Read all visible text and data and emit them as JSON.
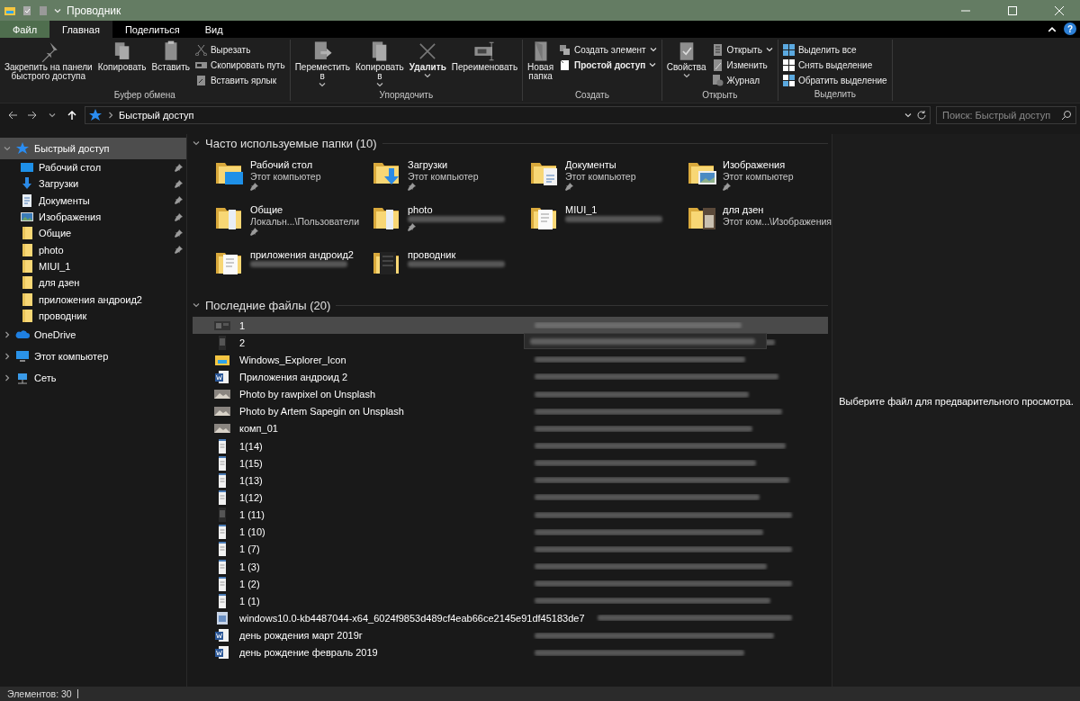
{
  "window": {
    "title": "Проводник"
  },
  "ribbon_tabs": [
    {
      "label": "Файл",
      "kind": "file",
      "selected": false
    },
    {
      "label": "Главная",
      "kind": "tab",
      "selected": true
    },
    {
      "label": "Поделиться",
      "kind": "tab",
      "selected": false
    },
    {
      "label": "Вид",
      "kind": "tab",
      "selected": false
    }
  ],
  "help_button": "?",
  "ribbon_groups": [
    {
      "label": "Буфер обмена",
      "items": [
        {
          "kind": "large",
          "lines": [
            "Закрепить на панели",
            "быстрого доступа"
          ],
          "dropdown": false,
          "bold": false
        },
        {
          "kind": "large",
          "lines": [
            "Копировать"
          ],
          "dropdown": false,
          "bold": false
        },
        {
          "kind": "large",
          "lines": [
            "Вставить"
          ],
          "dropdown": false,
          "bold": false
        },
        {
          "kind": "small",
          "lines": [
            "Вырезать"
          ],
          "dropdown": false,
          "bold": false
        },
        {
          "kind": "small",
          "lines": [
            "Скопировать путь"
          ],
          "dropdown": false,
          "bold": false
        },
        {
          "kind": "small",
          "lines": [
            "Вставить ярлык"
          ],
          "dropdown": false,
          "bold": false
        }
      ]
    },
    {
      "label": "Упорядочить",
      "items": [
        {
          "kind": "large",
          "lines": [
            "Переместить",
            "в"
          ],
          "dropdown": true,
          "bold": false
        },
        {
          "kind": "large",
          "lines": [
            "Копировать",
            "в"
          ],
          "dropdown": true,
          "bold": false
        },
        {
          "kind": "large",
          "lines": [
            "Удалить"
          ],
          "dropdown": true,
          "bold": true
        },
        {
          "kind": "large",
          "lines": [
            "Переименовать"
          ],
          "dropdown": false,
          "bold": false
        }
      ]
    },
    {
      "label": "Создать",
      "items": [
        {
          "kind": "large",
          "lines": [
            "Новая",
            "папка"
          ],
          "dropdown": false,
          "bold": false
        },
        {
          "kind": "small",
          "lines": [
            "Создать элемент"
          ],
          "dropdown": true,
          "bold": false
        },
        {
          "kind": "small",
          "lines": [
            "Простой доступ"
          ],
          "dropdown": true,
          "bold": true
        }
      ]
    },
    {
      "label": "Открыть",
      "items": [
        {
          "kind": "large",
          "lines": [
            "Свойства"
          ],
          "dropdown": true,
          "bold": false
        },
        {
          "kind": "small",
          "lines": [
            "Открыть"
          ],
          "dropdown": true,
          "bold": false
        },
        {
          "kind": "small",
          "lines": [
            "Изменить"
          ],
          "dropdown": false,
          "bold": false
        },
        {
          "kind": "small",
          "lines": [
            "Журнал"
          ],
          "dropdown": false,
          "bold": false
        }
      ]
    },
    {
      "label": "Выделить",
      "items": [
        {
          "kind": "small",
          "lines": [
            "Выделить все"
          ],
          "dropdown": false,
          "bold": false
        },
        {
          "kind": "small",
          "lines": [
            "Снять выделение"
          ],
          "dropdown": false,
          "bold": false
        },
        {
          "kind": "small",
          "lines": [
            "Обратить выделение"
          ],
          "dropdown": false,
          "bold": false
        }
      ]
    }
  ],
  "address": {
    "path": "Быстрый доступ",
    "search_placeholder": "Поиск: Быстрый доступ"
  },
  "sidebar": {
    "items": [
      {
        "label": "Быстрый доступ",
        "kind": "quick-access",
        "selected": true,
        "expanded": true,
        "children": [
          {
            "label": "Рабочий стол",
            "kind": "desktop",
            "pinned": true
          },
          {
            "label": "Загрузки",
            "kind": "downloads",
            "pinned": true
          },
          {
            "label": "Документы",
            "kind": "documents",
            "pinned": true
          },
          {
            "label": "Изображения",
            "kind": "pictures",
            "pinned": true
          },
          {
            "label": "Общие",
            "kind": "folder",
            "pinned": true
          },
          {
            "label": "photo",
            "kind": "folder",
            "pinned": true
          },
          {
            "label": "MIUI_1",
            "kind": "folder",
            "pinned": false
          },
          {
            "label": "для дзен",
            "kind": "folder",
            "pinned": false
          },
          {
            "label": "приложения андроид2",
            "kind": "folder",
            "pinned": false
          },
          {
            "label": "проводник",
            "kind": "folder",
            "pinned": false
          }
        ]
      },
      {
        "label": "OneDrive",
        "kind": "onedrive",
        "selected": false,
        "expanded": false
      },
      {
        "label": "Этот компьютер",
        "kind": "computer",
        "selected": false,
        "expanded": false
      },
      {
        "label": "Сеть",
        "kind": "network",
        "selected": false,
        "expanded": false
      }
    ]
  },
  "frequent_folders": {
    "title": "Часто используемые папки (10)",
    "expanded": true,
    "items": [
      {
        "name": "Рабочий стол",
        "location": "Этот компьютер",
        "kind": "desktop",
        "pinned": true
      },
      {
        "name": "Загрузки",
        "location": "Этот компьютер",
        "kind": "downloads",
        "pinned": true
      },
      {
        "name": "Документы",
        "location": "Этот компьютер",
        "kind": "documents",
        "pinned": true
      },
      {
        "name": "Изображения",
        "location": "Этот компьютер",
        "kind": "pictures",
        "pinned": true
      },
      {
        "name": "Общие",
        "location": "Локальн...\\Пользователи",
        "kind": "folder",
        "pinned": true
      },
      {
        "name": "photo",
        "kind": "folder",
        "pinned": true
      },
      {
        "name": "MIUI_1",
        "kind": "pages",
        "pinned": false
      },
      {
        "name": "для дзен",
        "location": "Этот ком...\\Изображения",
        "kind": "photos",
        "pinned": false
      },
      {
        "name": "приложения андроид2",
        "kind": "pages",
        "pinned": false
      },
      {
        "name": "проводник",
        "kind": "dark",
        "pinned": false
      }
    ]
  },
  "recent_files": {
    "title": "Последние файлы (20)",
    "expanded": true,
    "items": [
      {
        "name": "1",
        "kind": "screenshot",
        "selected": true,
        "tooltip": false
      },
      {
        "name": "2",
        "kind": "phone-dark",
        "selected": false,
        "tooltip": true
      },
      {
        "name": "Windows_Explorer_Icon",
        "kind": "explorer",
        "selected": false,
        "tooltip": false
      },
      {
        "name": "Приложения андроид 2",
        "kind": "word",
        "selected": false,
        "tooltip": false
      },
      {
        "name": "Photo by rawpixel on Unsplash",
        "kind": "photo",
        "selected": false,
        "tooltip": false
      },
      {
        "name": "Photo by Artem Sapegin on Unsplash",
        "kind": "photo",
        "selected": false,
        "tooltip": false
      },
      {
        "name": "комп_01",
        "kind": "photo",
        "selected": false,
        "tooltip": false
      },
      {
        "name": "1(14)",
        "kind": "phone",
        "selected": false,
        "tooltip": false
      },
      {
        "name": "1(15)",
        "kind": "phone",
        "selected": false,
        "tooltip": false
      },
      {
        "name": "1(13)",
        "kind": "phone",
        "selected": false,
        "tooltip": false
      },
      {
        "name": "1(12)",
        "kind": "phone",
        "selected": false,
        "tooltip": false
      },
      {
        "name": "1 (11)",
        "kind": "phone-dark",
        "selected": false,
        "tooltip": false
      },
      {
        "name": "1 (10)",
        "kind": "phone",
        "selected": false,
        "tooltip": false
      },
      {
        "name": "1 (7)",
        "kind": "phone",
        "selected": false,
        "tooltip": false
      },
      {
        "name": "1 (3)",
        "kind": "phone",
        "selected": false,
        "tooltip": false
      },
      {
        "name": "1 (2)",
        "kind": "phone",
        "selected": false,
        "tooltip": false
      },
      {
        "name": "1 (1)",
        "kind": "phone",
        "selected": false,
        "tooltip": false
      },
      {
        "name": "windows10.0-kb4487044-x64_6024f9853d489cf4eab66ce2145e91df45183de7",
        "kind": "installer",
        "selected": false,
        "tooltip": false
      },
      {
        "name": "день рождения март 2019г",
        "kind": "word",
        "selected": false,
        "tooltip": false
      },
      {
        "name": "день рождение февраль 2019",
        "kind": "word",
        "selected": false,
        "tooltip": false
      }
    ]
  },
  "preview": {
    "message": "Выберите файл для предварительного просмотра."
  },
  "status_bar": {
    "count": "Элементов: 30"
  }
}
